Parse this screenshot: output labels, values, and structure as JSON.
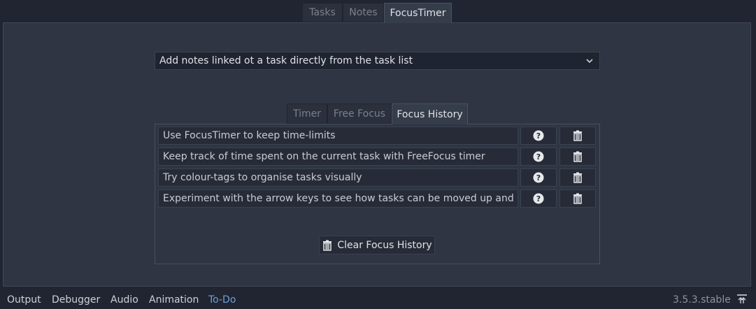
{
  "top_tabs": [
    {
      "label": "Tasks",
      "active": false
    },
    {
      "label": "Notes",
      "active": false
    },
    {
      "label": "FocusTimer",
      "active": true
    }
  ],
  "tip_select": {
    "value": "Add notes linked ot a task directly from the task list"
  },
  "focus_tabs": [
    {
      "label": "Timer",
      "active": false
    },
    {
      "label": "Free Focus",
      "active": false
    },
    {
      "label": "Focus History",
      "active": true
    }
  ],
  "history": [
    {
      "text": "Use FocusTimer to keep time-limits"
    },
    {
      "text": "Keep track of time spent on the current task with FreeFocus timer"
    },
    {
      "text": "Try colour-tags to organise tasks visually"
    },
    {
      "text": "Experiment with the arrow keys to see how tasks can be moved up and do"
    }
  ],
  "clear_button": {
    "label": "Clear Focus History"
  },
  "bottom_bar": {
    "items": [
      "Output",
      "Debugger",
      "Audio",
      "Animation",
      "To-Do"
    ],
    "active_item": "To-Do",
    "version": "3.5.3.stable"
  },
  "colors": {
    "background": "#202531",
    "panel": "#2f3542",
    "accent": "#6f9fd6"
  }
}
